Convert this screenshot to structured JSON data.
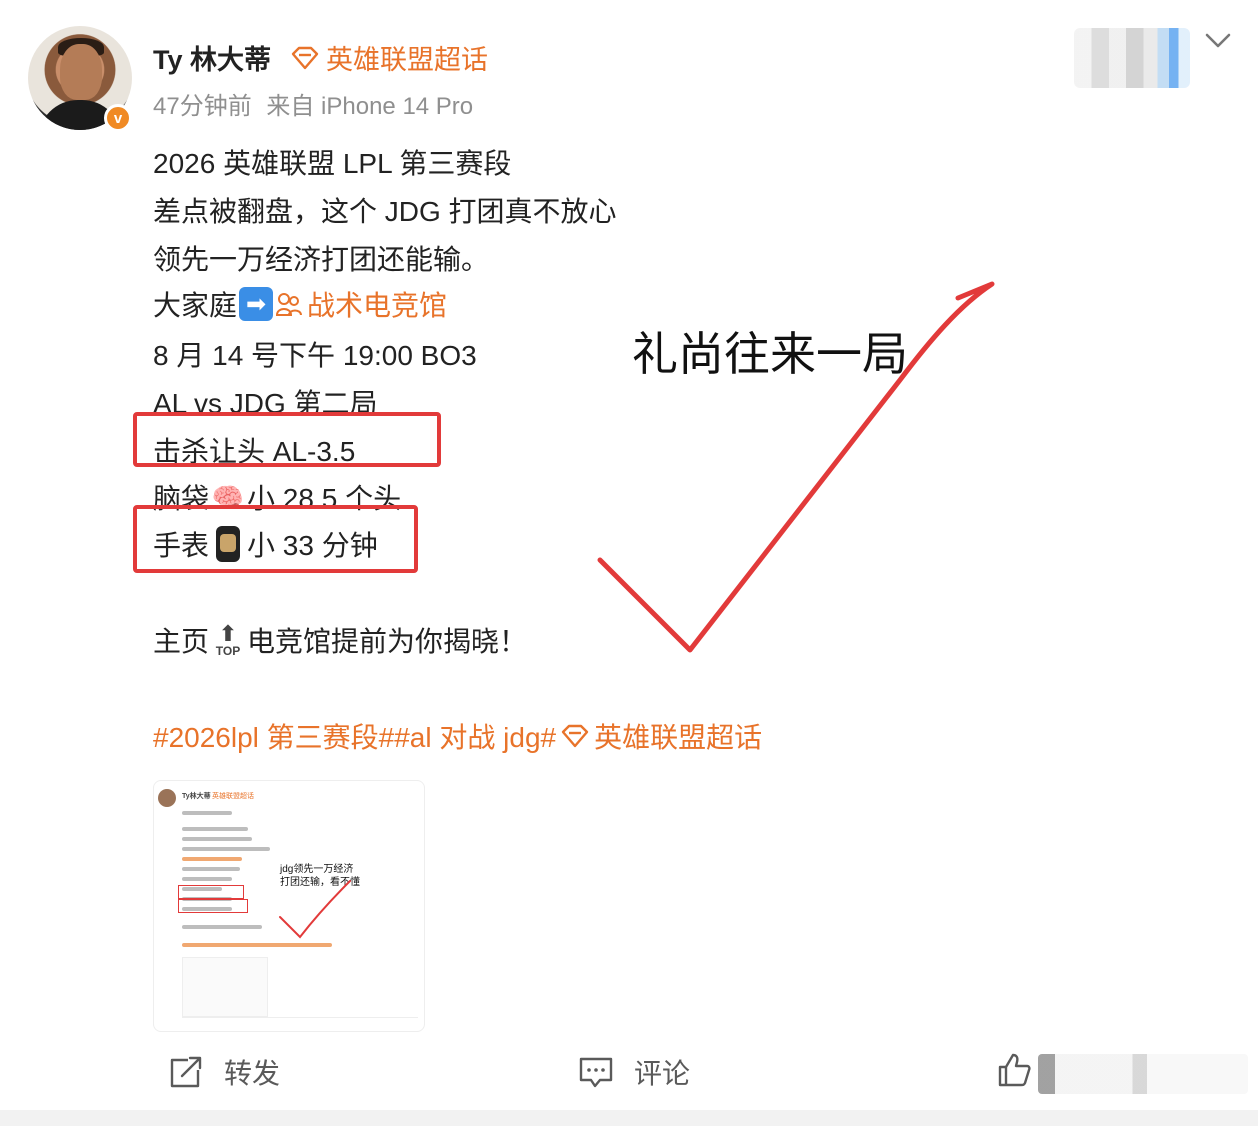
{
  "post": {
    "author": "Ty 林大蒂",
    "verified_badge": "v",
    "supertopic": "英雄联盟超话",
    "time": "47分钟前",
    "source": "来自 iPhone 14 Pro",
    "lines": [
      "2026 英雄联盟 LPL 第三赛段",
      "差点被翻盘，这个 JDG 打团真不放心",
      "领先一万经济打团还能输。",
      "大家庭",
      "战术电竞馆",
      "8 月 14 号下午 19:00 BO3",
      "AL vs JDG 第二局",
      "击杀让头 AL-3.5",
      "脑袋",
      "小 28.5 个头",
      "手表",
      "小 33 分钟",
      "主页",
      "电竞馆提前为你揭晓！"
    ],
    "hashtags": [
      "#2026lpl 第三赛段#",
      "#al 对战 jdg#",
      "英雄联盟超话"
    ],
    "annotation": "礼尚往来一局",
    "emoji": {
      "arrow": "➡",
      "brain": "🧠",
      "top_arrow": "⬆",
      "top_label": "TOP"
    }
  },
  "thumbnail": {
    "name": "Ty林大蒂",
    "topic": "英雄联盟超话",
    "annotation_line1": "jdg领先一万经济",
    "annotation_line2": "打团还输，看不懂"
  },
  "actions": {
    "repost": "转发",
    "comment": "评论"
  },
  "colors": {
    "accent": "#e8732a",
    "annotation_red": "#e23a3a",
    "text": "#222222",
    "meta": "#8f8f8f"
  },
  "icons": [
    "chevron-down-icon",
    "supertopic-diamond-icon",
    "repost-icon",
    "comment-icon",
    "like-icon"
  ]
}
